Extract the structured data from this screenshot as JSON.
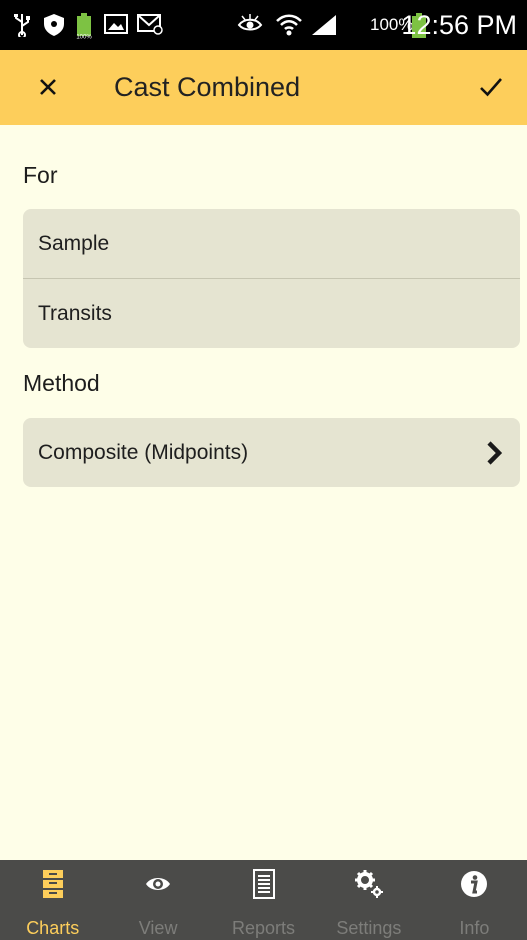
{
  "status_bar": {
    "battery_percent": "100%",
    "time": "12:56 PM"
  },
  "app_bar": {
    "title": "Cast Combined"
  },
  "for_section": {
    "label": "For",
    "items": [
      "Sample",
      "Transits"
    ]
  },
  "method_section": {
    "label": "Method",
    "value": "Composite (Midpoints)"
  },
  "bottom_nav": {
    "items": [
      {
        "label": "Charts",
        "icon": "charts-icon",
        "active": true
      },
      {
        "label": "View",
        "icon": "eye-icon",
        "active": false
      },
      {
        "label": "Reports",
        "icon": "reports-icon",
        "active": false
      },
      {
        "label": "Settings",
        "icon": "gears-icon",
        "active": false
      },
      {
        "label": "Info",
        "icon": "info-icon",
        "active": false
      }
    ]
  },
  "colors": {
    "accent": "#fdce5b",
    "background": "#fefee8",
    "card": "#e5e4d1",
    "nav_bg": "#4b4b49",
    "nav_inactive": "#7d7d7a"
  }
}
